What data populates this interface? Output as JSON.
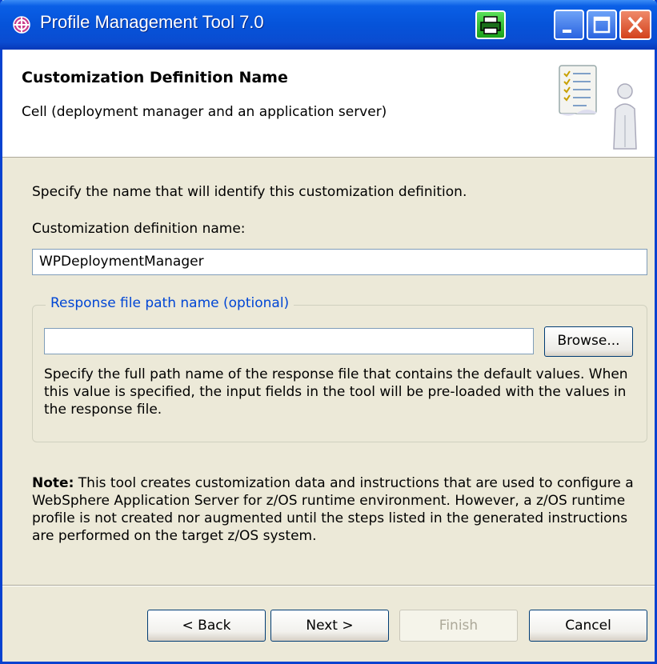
{
  "window": {
    "title": "Profile Management Tool 7.0"
  },
  "header": {
    "title": "Customization Definition Name",
    "subtitle": "Cell (deployment manager and an application server)"
  },
  "main": {
    "intro": "Specify the name that will identify this customization definition.",
    "name_label": "Customization definition name:",
    "name_value": "WPDeploymentManager",
    "response_group": {
      "legend": "Response file path name (optional)",
      "path_value": "",
      "browse_label": "Browse...",
      "description": "Specify the full path name of the response file that contains the default values. When this value is specified, the input fields in the tool will be pre-loaded with the values in the response file."
    },
    "note": {
      "label": "Note:",
      "text": " This tool creates customization data and instructions that are used to configure a WebSphere Application Server for z/OS runtime environment. However, a z/OS runtime profile is not created nor augmented until the steps listed in the generated instructions are performed on the target z/OS system."
    }
  },
  "buttons": {
    "back": "< Back",
    "next": "Next >",
    "finish": "Finish",
    "cancel": "Cancel"
  },
  "icons": {
    "app": "profile-tool-icon",
    "print": "printer-icon",
    "minimize": "minimize-icon",
    "maximize": "maximize-icon",
    "close": "close-icon",
    "header": "checklist-person-icon"
  },
  "colors": {
    "titlebar": "#0653d9",
    "legend_text": "#0046d5",
    "dialog_bg": "#ece9d8"
  }
}
